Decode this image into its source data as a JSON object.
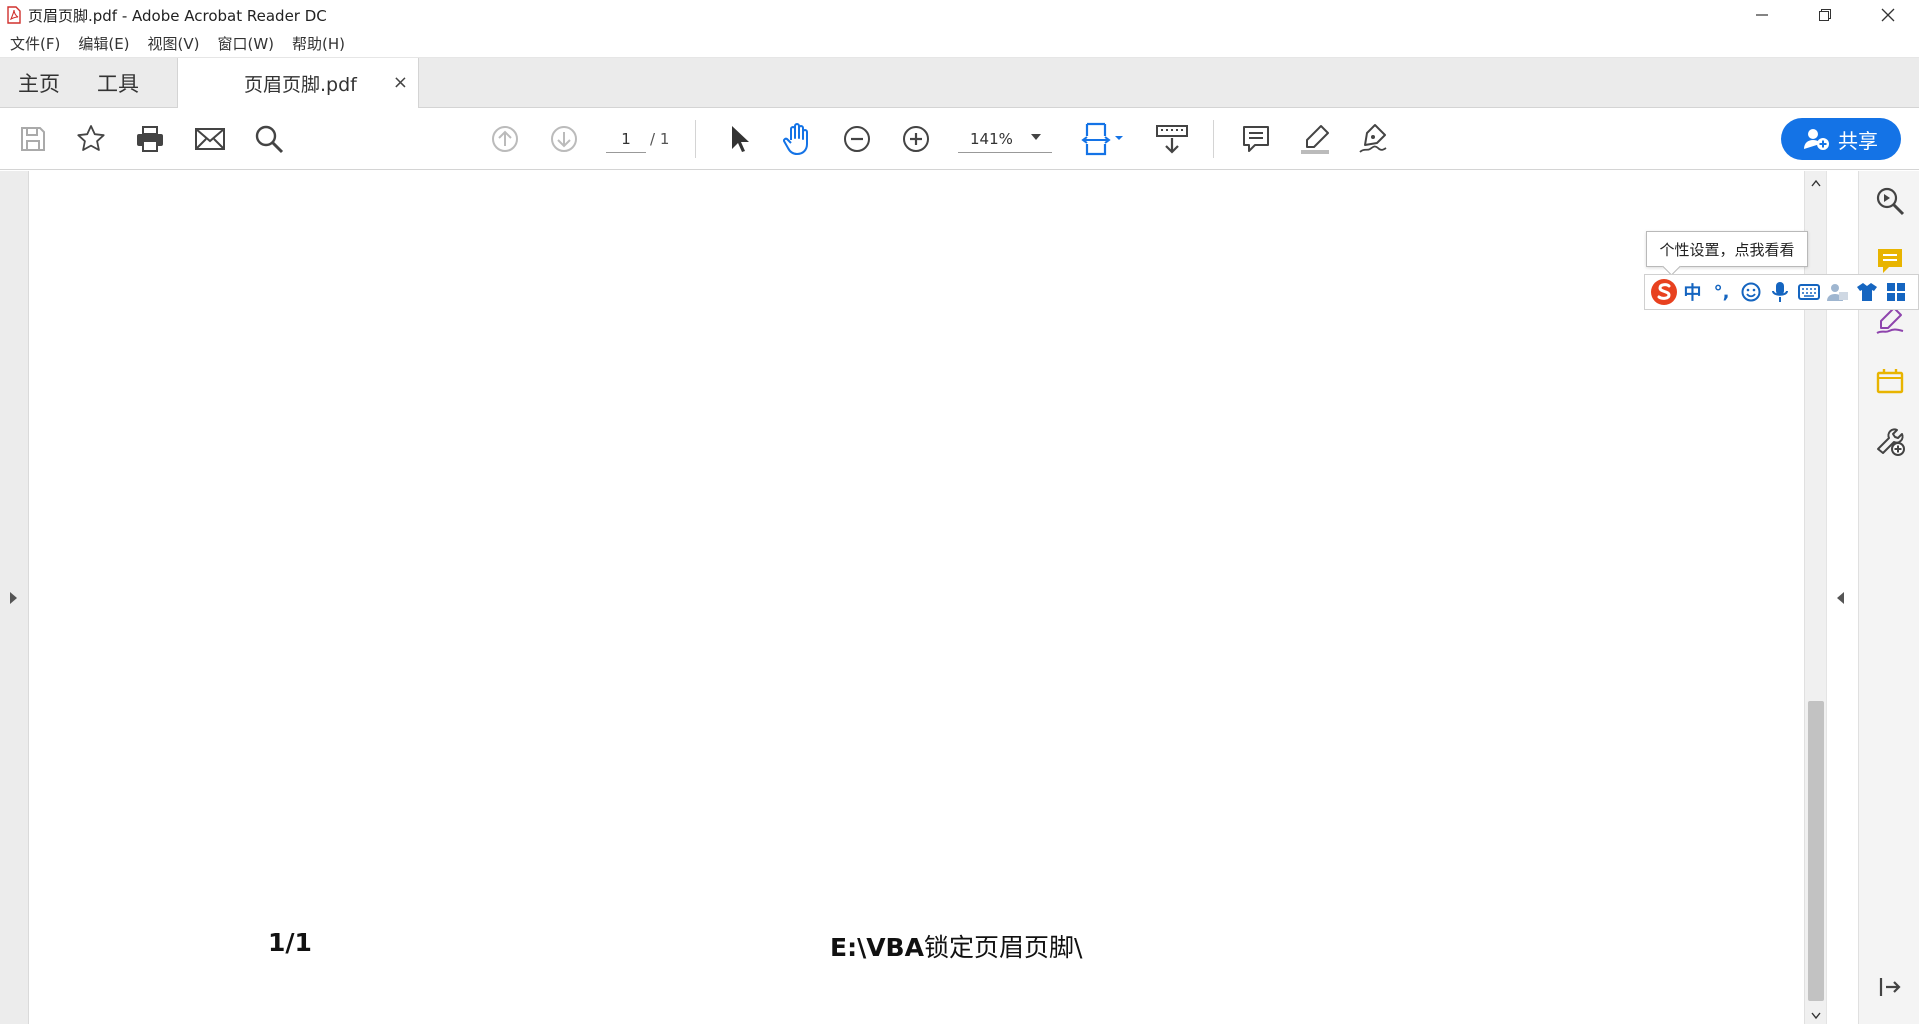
{
  "window": {
    "title": "页眉页脚.pdf - Adobe Acrobat Reader DC"
  },
  "menu": {
    "items": [
      "文件(F)",
      "编辑(E)",
      "视图(V)",
      "窗口(W)",
      "帮助(H)"
    ]
  },
  "tabs": {
    "home": "主页",
    "tools": "工具",
    "document": "页眉页脚.pdf",
    "close": "×"
  },
  "toolbar": {
    "page_current": "1",
    "page_total": "/ 1",
    "zoom": "141%",
    "share_label": "共享"
  },
  "document": {
    "footer_page": "1/1",
    "footer_path_bold": "E:\\VBA",
    "footer_path_text": "锁定页眉页脚\\"
  },
  "ime": {
    "tooltip": "个性设置，点我看看",
    "mode": "中",
    "punct": "°,"
  },
  "colors": {
    "accent": "#1473e6",
    "comment": "#e8b400",
    "fill_sign": "#8e44ad",
    "stamp": "#e8b400",
    "ime_logo": "#e8411f"
  }
}
